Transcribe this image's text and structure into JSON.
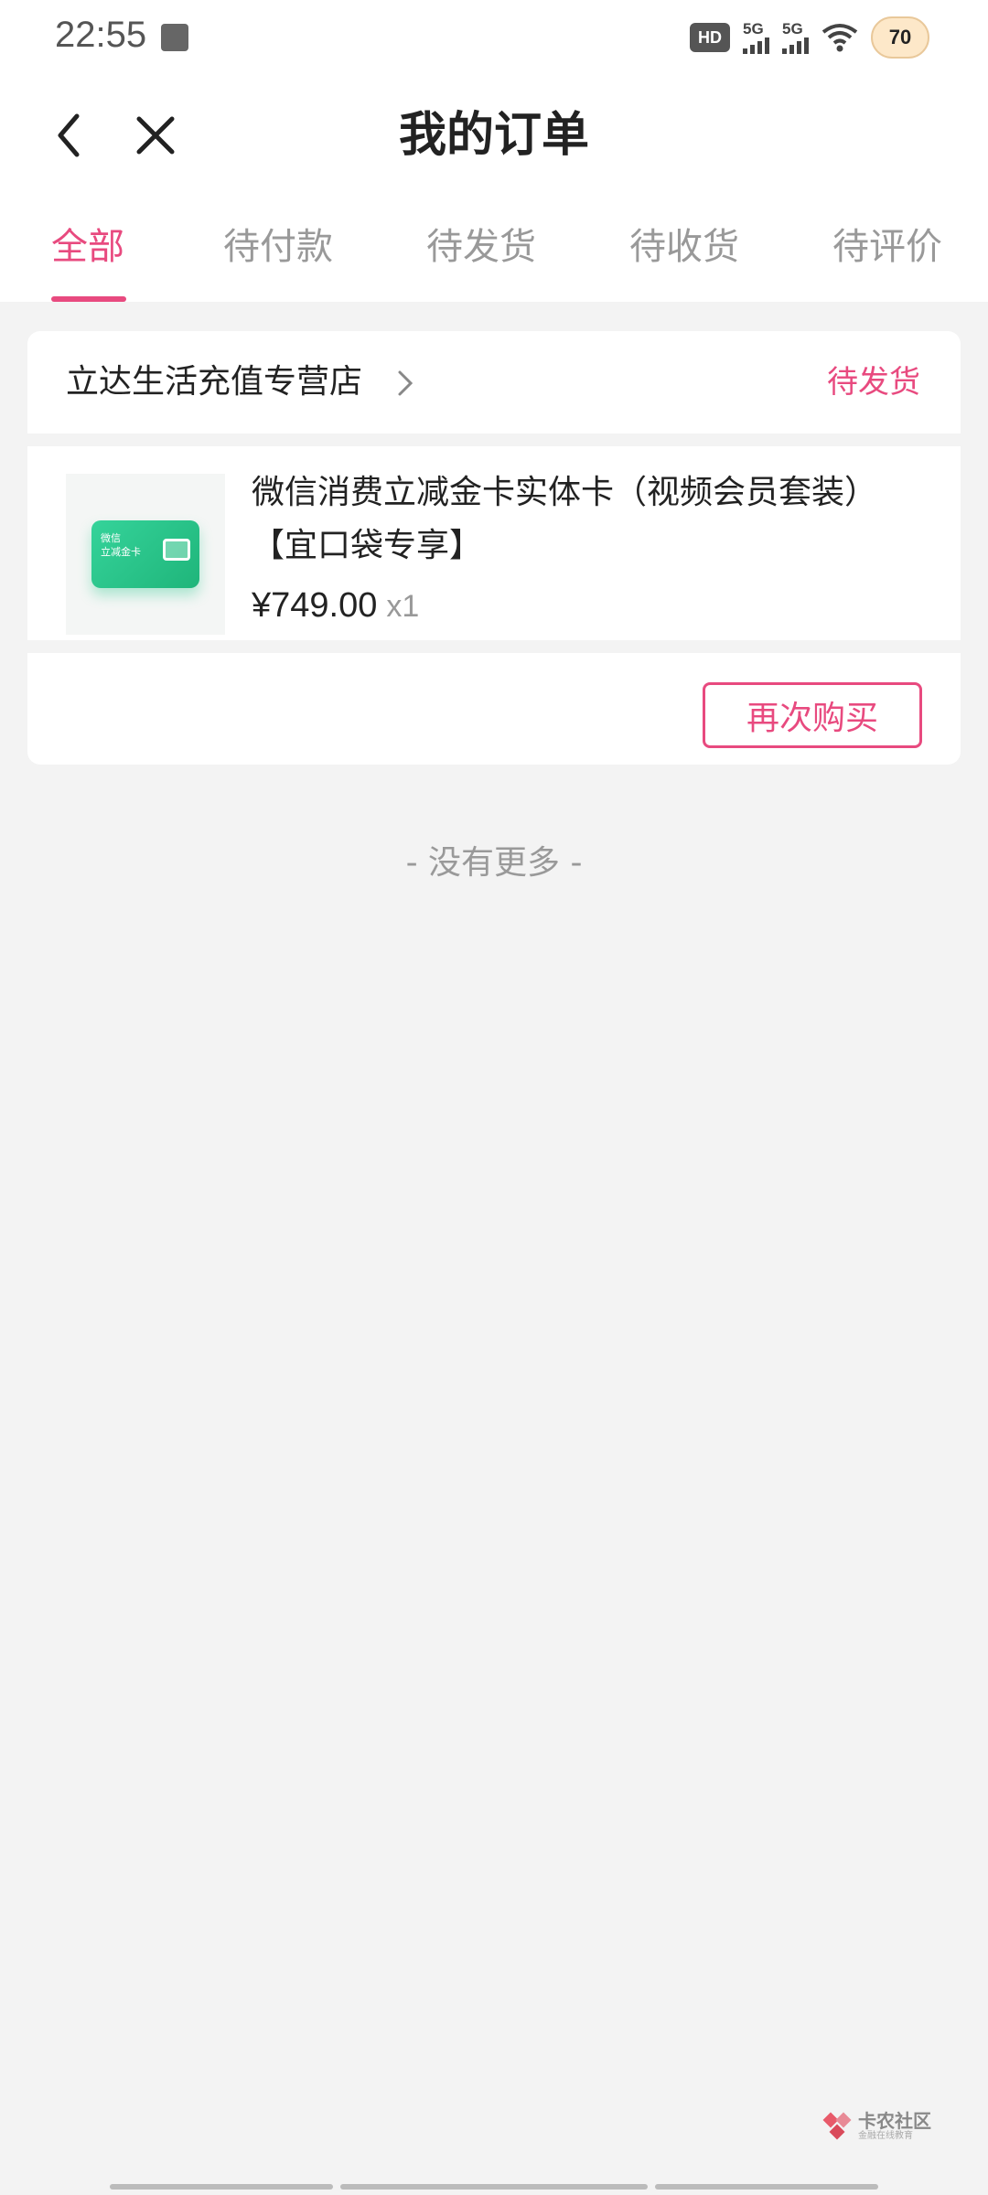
{
  "status_bar": {
    "time": "22:55",
    "hd_label": "HD",
    "signal_1": "5G",
    "signal_2": "5G",
    "battery": "70",
    "icons": [
      "notification-square-icon",
      "hd-icon",
      "signal-icon",
      "wifi-icon",
      "battery-icon"
    ]
  },
  "header": {
    "title": "我的订单",
    "back_icon": "chevron-left-icon",
    "close_icon": "close-icon"
  },
  "tabs": [
    {
      "label": "全部",
      "active": true
    },
    {
      "label": "待付款",
      "active": false
    },
    {
      "label": "待发货",
      "active": false
    },
    {
      "label": "待收货",
      "active": false
    },
    {
      "label": "待评价",
      "active": false
    }
  ],
  "order": {
    "shop_name": "立达生活充值专营店",
    "status": "待发货",
    "product": {
      "title": "微信消费立减金卡实体卡（视频会员套装）【宜口袋专享】",
      "image_caption_1": "微信",
      "image_caption_2": "立减金卡",
      "price": "¥749.00",
      "quantity": "x1"
    },
    "rebuy_label": "再次购买"
  },
  "footer_text": "- 没有更多 -",
  "watermark": {
    "main": "卡农社区",
    "sub": "金融在线教育"
  },
  "colors": {
    "accent": "#e84a7f",
    "background": "#f3f3f3"
  }
}
